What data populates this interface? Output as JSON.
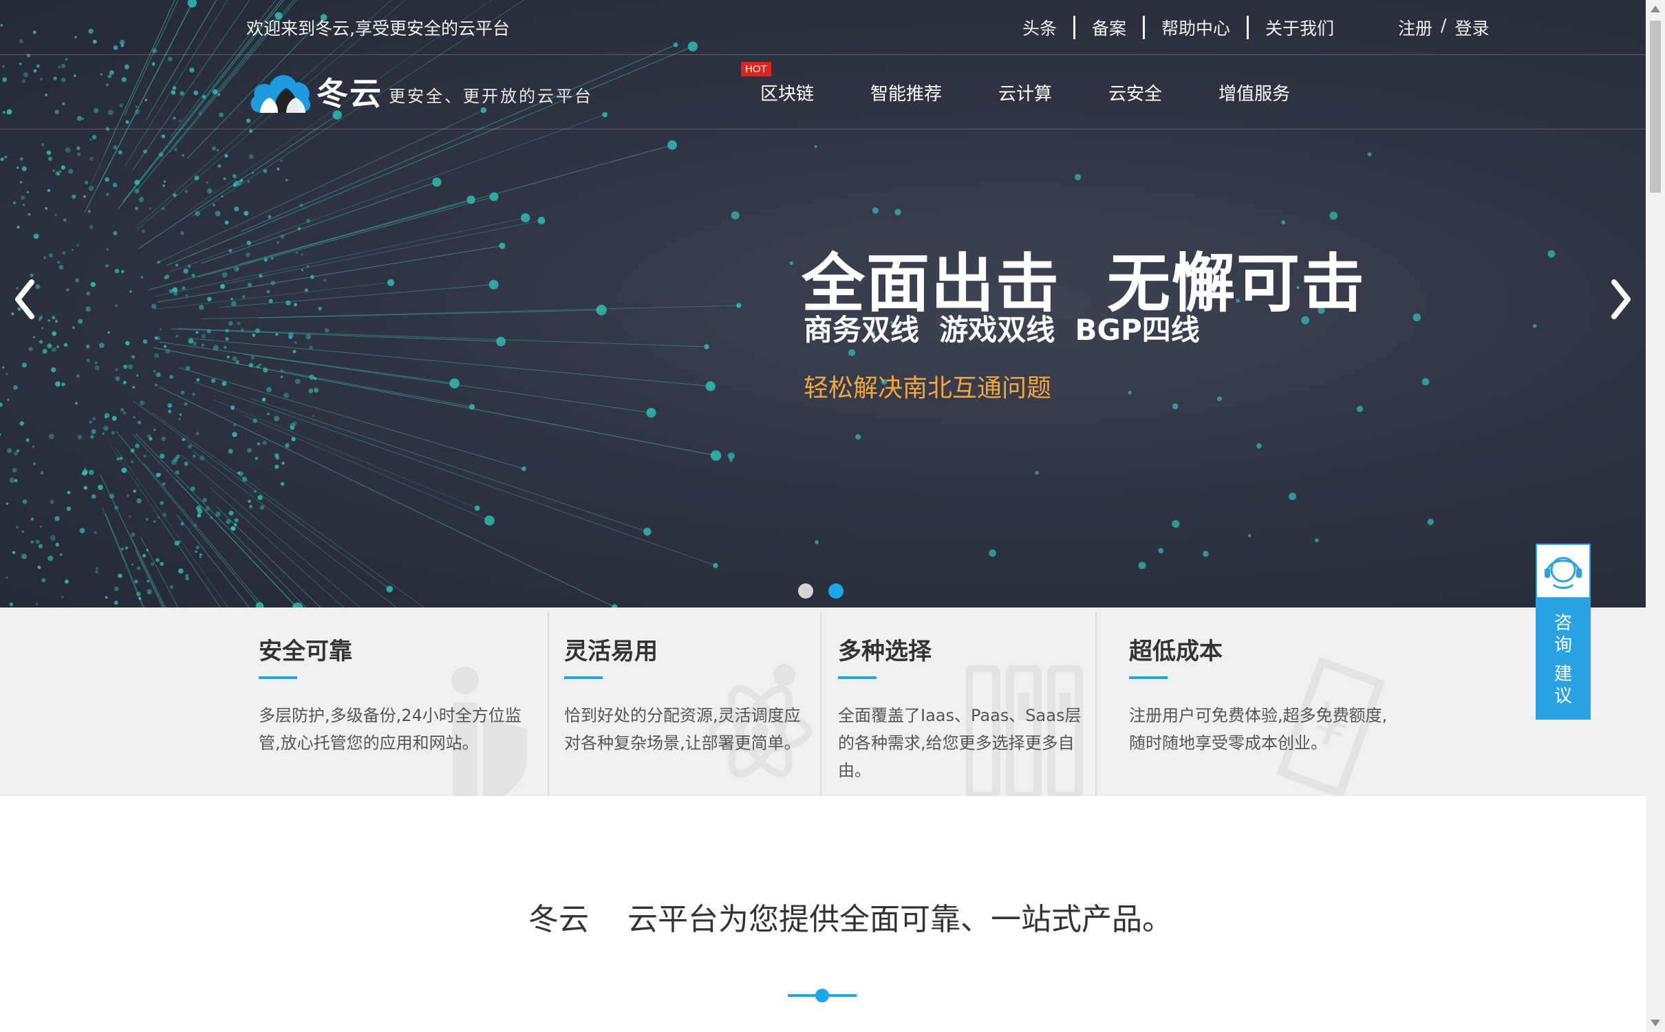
{
  "colors": {
    "hero_bg": "#2f3343",
    "accent": "#1ea7e6",
    "headline_orange": "#f2a63b",
    "hot_badge": "#e1251b",
    "consult_bg": "#2ba3e3"
  },
  "topbar": {
    "welcome": "欢迎来到冬云,享受更安全的云平台",
    "links": [
      "头条",
      "备案",
      "帮助中心",
      "关于我们"
    ],
    "register": "注册",
    "auth_sep": "/",
    "login": "登录"
  },
  "nav": {
    "logo_text": "冬云",
    "slogan": "更安全、更开放的云平台",
    "hot_badge": "HOT",
    "items": [
      "区块链",
      "智能推荐",
      "云计算",
      "云安全",
      "增值服务"
    ]
  },
  "hero": {
    "headline": "全面出击  无懈可击",
    "subline": "商务双线  游戏双线  BGP四线",
    "tagline": "轻松解决南北互通问题",
    "prev_icon": "chevron-left-icon",
    "next_icon": "chevron-right-icon",
    "slide_count": 2,
    "active_slide": 2
  },
  "features": [
    {
      "title": "安全可靠",
      "desc": [
        "多层防护,多级备份,24小时全方位监",
        "管,放心托管您的应用和网站。"
      ],
      "icon": "person-shield-icon"
    },
    {
      "title": "灵活易用",
      "desc": [
        "恰到好处的分配资源,灵活调度应",
        "对各种复杂场景,让部署更简单。"
      ],
      "icon": "atom-icon"
    },
    {
      "title": "多种选择",
      "desc": [
        "全面覆盖了Iaas、Paas、Saas层",
        "的各种需求,给您更多选择更多自",
        "由。"
      ],
      "icon": "server-icon"
    },
    {
      "title": "超低成本",
      "desc": [
        "注册用户可免费体验,超多免费额度,",
        "随时随地享受零成本创业。"
      ],
      "icon": "yen-tag-icon"
    }
  ],
  "intro": {
    "text": "冬云    云平台为您提供全面可靠、一站式产品。"
  },
  "consult": {
    "chars": [
      "咨",
      "询",
      "建",
      "议"
    ],
    "icon": "headset-icon"
  }
}
